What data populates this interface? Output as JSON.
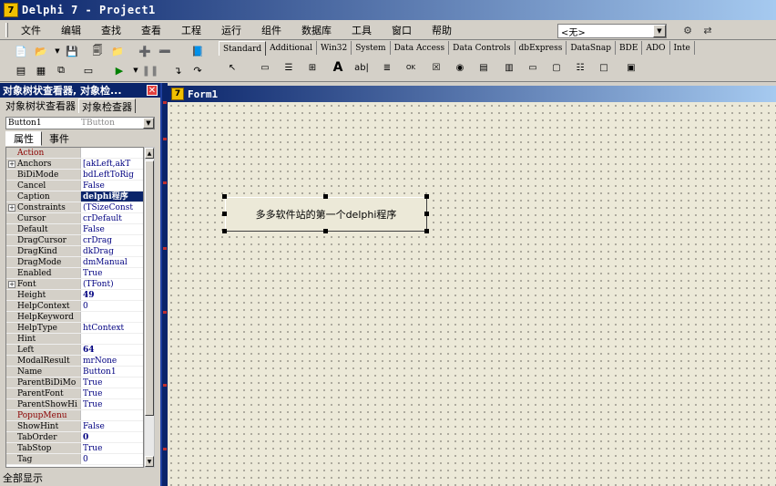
{
  "window": {
    "title": "Delphi 7 - Project1"
  },
  "menu": [
    "文件",
    "编辑",
    "查找",
    "查看",
    "工程",
    "运行",
    "组件",
    "数据库",
    "工具",
    "窗口",
    "帮助"
  ],
  "combo": {
    "value": "<无>"
  },
  "palette": {
    "tabs": [
      "Standard",
      "Additional",
      "Win32",
      "System",
      "Data Access",
      "Data Controls",
      "dbExpress",
      "DataSnap",
      "BDE",
      "ADO",
      "Inte"
    ],
    "active": "Standard"
  },
  "inspector": {
    "title": "对象树状查看器, 对象检...",
    "tabs": [
      "对象树状查看器",
      "对象检查器"
    ],
    "object_name": "Button1",
    "object_type": "TButton",
    "prop_tabs": [
      "属性",
      "事件"
    ],
    "rows": [
      {
        "name": "Action",
        "value": "",
        "event": true
      },
      {
        "name": "Anchors",
        "value": "[akLeft,akT",
        "plus": true
      },
      {
        "name": "BiDiMode",
        "value": "bdLeftToRig"
      },
      {
        "name": "Cancel",
        "value": "False"
      },
      {
        "name": "Caption",
        "value": "delphi程序",
        "selected": true
      },
      {
        "name": "Constraints",
        "value": "(TSizeConst",
        "plus": true
      },
      {
        "name": "Cursor",
        "value": "crDefault"
      },
      {
        "name": "Default",
        "value": "False"
      },
      {
        "name": "DragCursor",
        "value": "crDrag"
      },
      {
        "name": "DragKind",
        "value": "dkDrag"
      },
      {
        "name": "DragMode",
        "value": "dmManual"
      },
      {
        "name": "Enabled",
        "value": "True"
      },
      {
        "name": "Font",
        "value": "(TFont)",
        "plus": true
      },
      {
        "name": "Height",
        "value": "49",
        "bold": true
      },
      {
        "name": "HelpContext",
        "value": "0"
      },
      {
        "name": "HelpKeyword",
        "value": ""
      },
      {
        "name": "HelpType",
        "value": "htContext"
      },
      {
        "name": "Hint",
        "value": ""
      },
      {
        "name": "Left",
        "value": "64",
        "bold": true
      },
      {
        "name": "ModalResult",
        "value": "mrNone"
      },
      {
        "name": "Name",
        "value": "Button1"
      },
      {
        "name": "ParentBiDiMo",
        "value": "True"
      },
      {
        "name": "ParentFont",
        "value": "True"
      },
      {
        "name": "ParentShowHi",
        "value": "True"
      },
      {
        "name": "PopupMenu",
        "value": "",
        "event": true
      },
      {
        "name": "ShowHint",
        "value": "False"
      },
      {
        "name": "TabOrder",
        "value": "0",
        "bold": true
      },
      {
        "name": "TabStop",
        "value": "True"
      },
      {
        "name": "Tag",
        "value": "0"
      }
    ],
    "status": "全部显示"
  },
  "form": {
    "title": "Form1",
    "button_caption": "多多软件站的第一个delphi程序"
  }
}
